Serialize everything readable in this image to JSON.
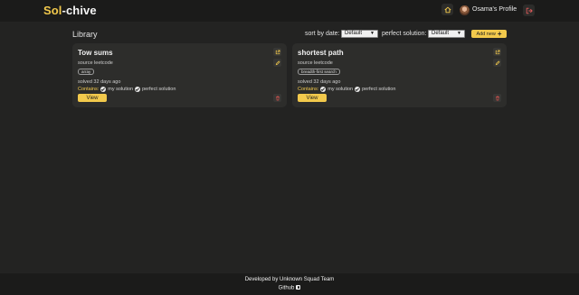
{
  "header": {
    "logo_part1": "Sol",
    "logo_part2": "-chive",
    "profile_name": "Osama's Profile",
    "icons": {
      "home": "home-icon",
      "logout": "logout-icon"
    }
  },
  "toolbar": {
    "title": "Library",
    "sort_label": "sort by date:",
    "sort_value": "Default",
    "perfect_label": "perfect solution:",
    "perfect_value": "Default",
    "add_new_label": "Add new"
  },
  "cards": [
    {
      "title": "Tow sums",
      "source": "source leetcode",
      "tag": "array",
      "solved": "solved 32 days ago",
      "contains_label": "Contains:",
      "contains": [
        "my solution",
        "perfect solution"
      ],
      "view_label": "View"
    },
    {
      "title": "shortest path",
      "source": "source leetcode",
      "tag": "breadth-first search",
      "solved": "solved 32 days ago",
      "contains_label": "Contains:",
      "contains": [
        "my solution",
        "perfect solution"
      ],
      "view_label": "View"
    }
  ],
  "footer": {
    "credit": "Developed by Unknown Squad Team",
    "github": "Github"
  },
  "colors": {
    "accent": "#f2c94c",
    "background": "#232322",
    "card": "#2d2d2b",
    "header": "#1b1b1a",
    "delete": "#d9534f"
  }
}
